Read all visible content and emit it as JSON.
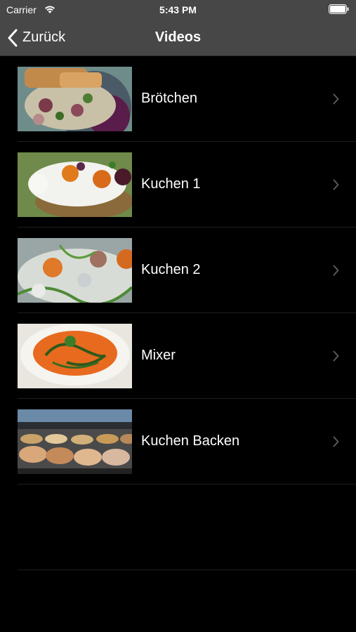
{
  "status": {
    "carrier": "Carrier",
    "time": "5:43 PM",
    "wifi_icon": "wifi-icon",
    "battery_icon": "battery-icon"
  },
  "nav": {
    "back_label": "Zurück",
    "title": "Videos",
    "back_icon": "chevron-left-icon"
  },
  "colors": {
    "bar_background": "#474747",
    "list_background": "#000000",
    "separator": "#1f1f1f",
    "chevron": "#5a5a5a"
  },
  "videos": [
    {
      "label": "Brötchen",
      "thumbnail": "food-thumbnail-1"
    },
    {
      "label": "Kuchen 1",
      "thumbnail": "food-thumbnail-2"
    },
    {
      "label": "Kuchen 2",
      "thumbnail": "food-thumbnail-3"
    },
    {
      "label": "Mixer",
      "thumbnail": "soup-thumbnail"
    },
    {
      "label": "Kuchen Backen",
      "thumbnail": "cakes-display-thumbnail"
    }
  ]
}
